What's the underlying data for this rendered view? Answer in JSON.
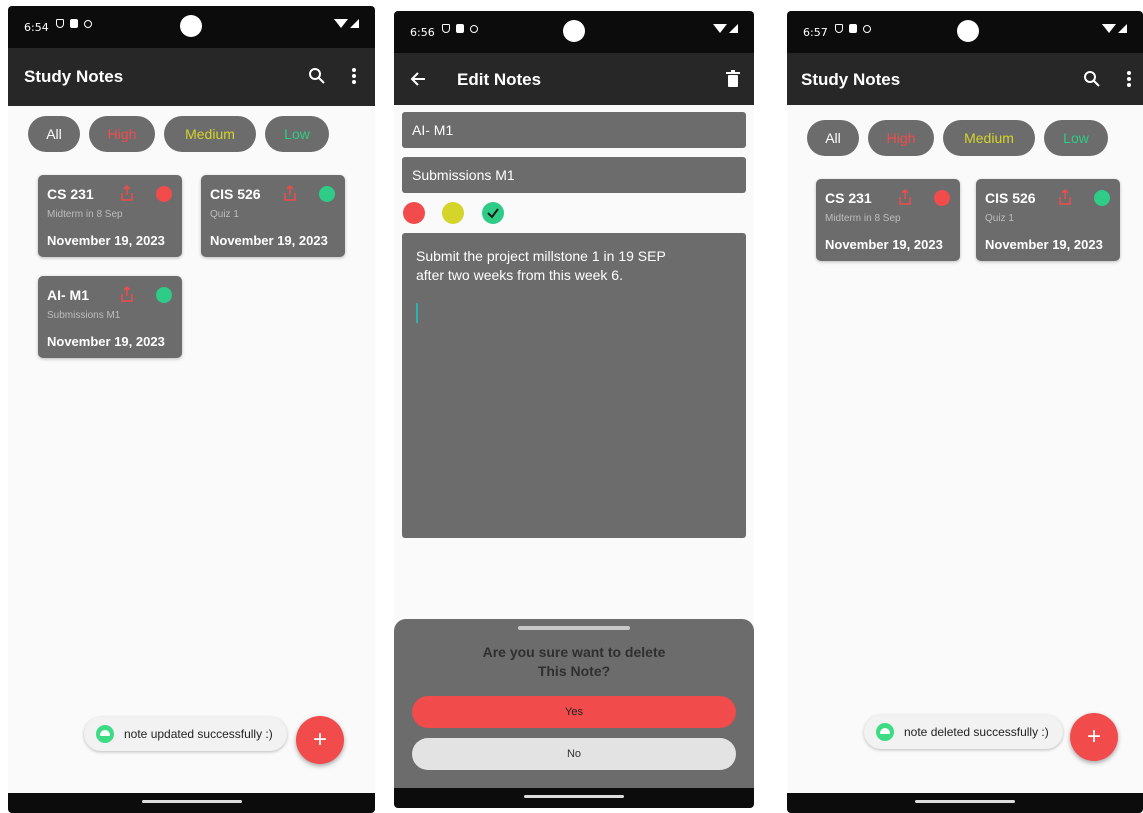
{
  "colors": {
    "high": "#f24b4b",
    "medium": "#d4d42a",
    "low": "#2ecc87"
  },
  "screens": [
    {
      "status_time": "6:54",
      "app_title": "Study Notes",
      "filters": [
        "All",
        "High",
        "Medium",
        "Low"
      ],
      "notes": [
        {
          "title": "CS 231",
          "subtitle": "Midterm in 8 Sep",
          "date": "November 19, 2023",
          "priority": "high"
        },
        {
          "title": "CIS 526",
          "subtitle": "Quiz 1",
          "date": "November 19, 2023",
          "priority": "low"
        },
        {
          "title": "AI- M1",
          "subtitle": "Submissions M1",
          "date": "November 19, 2023",
          "priority": "low"
        }
      ],
      "toast": "note updated successfully :)",
      "fab": "+"
    },
    {
      "status_time": "6:56",
      "app_title": "Edit Notes",
      "title_value": "AI- M1",
      "subtitle_value": "Submissions M1",
      "selected_priority": "low",
      "body_line1": "Submit the project millstone 1  in 19 SEP",
      "body_line2": "after two weeks from this week 6.",
      "dialog_q1": "Are you sure want to delete",
      "dialog_q2": "This Note?",
      "yes": "Yes",
      "no": "No"
    },
    {
      "status_time": "6:57",
      "app_title": "Study Notes",
      "filters": [
        "All",
        "High",
        "Medium",
        "Low"
      ],
      "notes": [
        {
          "title": "CS 231",
          "subtitle": "Midterm in 8 Sep",
          "date": "November 19, 2023",
          "priority": "high"
        },
        {
          "title": "CIS 526",
          "subtitle": "Quiz 1",
          "date": "November 19, 2023",
          "priority": "low"
        }
      ],
      "toast": "note deleted successfully :)",
      "fab": "+"
    }
  ]
}
